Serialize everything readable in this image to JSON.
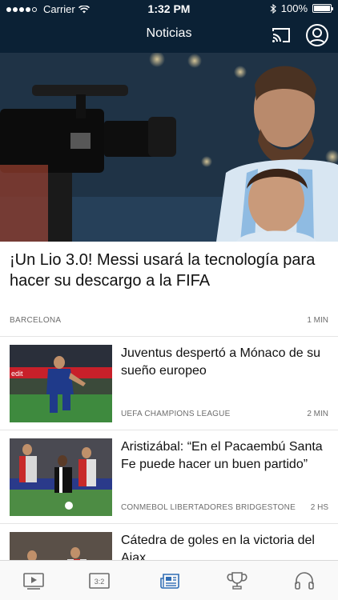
{
  "status_bar": {
    "carrier": "Carrier",
    "time": "1:32 PM",
    "battery": "100%"
  },
  "nav": {
    "title": "Noticias",
    "cast_icon": "cast-icon",
    "profile_icon": "profile-icon"
  },
  "hero": {
    "title": "¡Un Lio 3.0! Messi usará la tecnología para hacer su descargo a la FIFA",
    "category": "BARCELONA",
    "time": "1 MIN"
  },
  "articles": [
    {
      "title": "Juventus despertó a Mónaco de su sueño europeo",
      "category": "UEFA CHAMPIONS LEAGUE",
      "time": "2 MIN"
    },
    {
      "title": "Aristizábal: “En el Pacaembú Santa Fe puede hacer un buen partido”",
      "category": "CONMEBOL LIBERTADORES BRIDGESTONE",
      "time": "2 HS"
    },
    {
      "title": "Cátedra de goles en la victoria del Ajax",
      "category": "",
      "time": ""
    }
  ],
  "tabbar": {
    "tabs": [
      {
        "name": "video-tab",
        "icon": "play-icon"
      },
      {
        "name": "scores-tab",
        "icon": "scoreboard-icon",
        "label": "3:2"
      },
      {
        "name": "news-tab",
        "icon": "newspaper-icon"
      },
      {
        "name": "trophy-tab",
        "icon": "trophy-icon"
      },
      {
        "name": "audio-tab",
        "icon": "headphones-icon"
      }
    ],
    "active_color": "#2f6db5",
    "inactive_color": "#6b6b6b"
  },
  "colors": {
    "header_bg": "#0b2135",
    "text": "#111111",
    "meta": "#6d6d6d"
  }
}
